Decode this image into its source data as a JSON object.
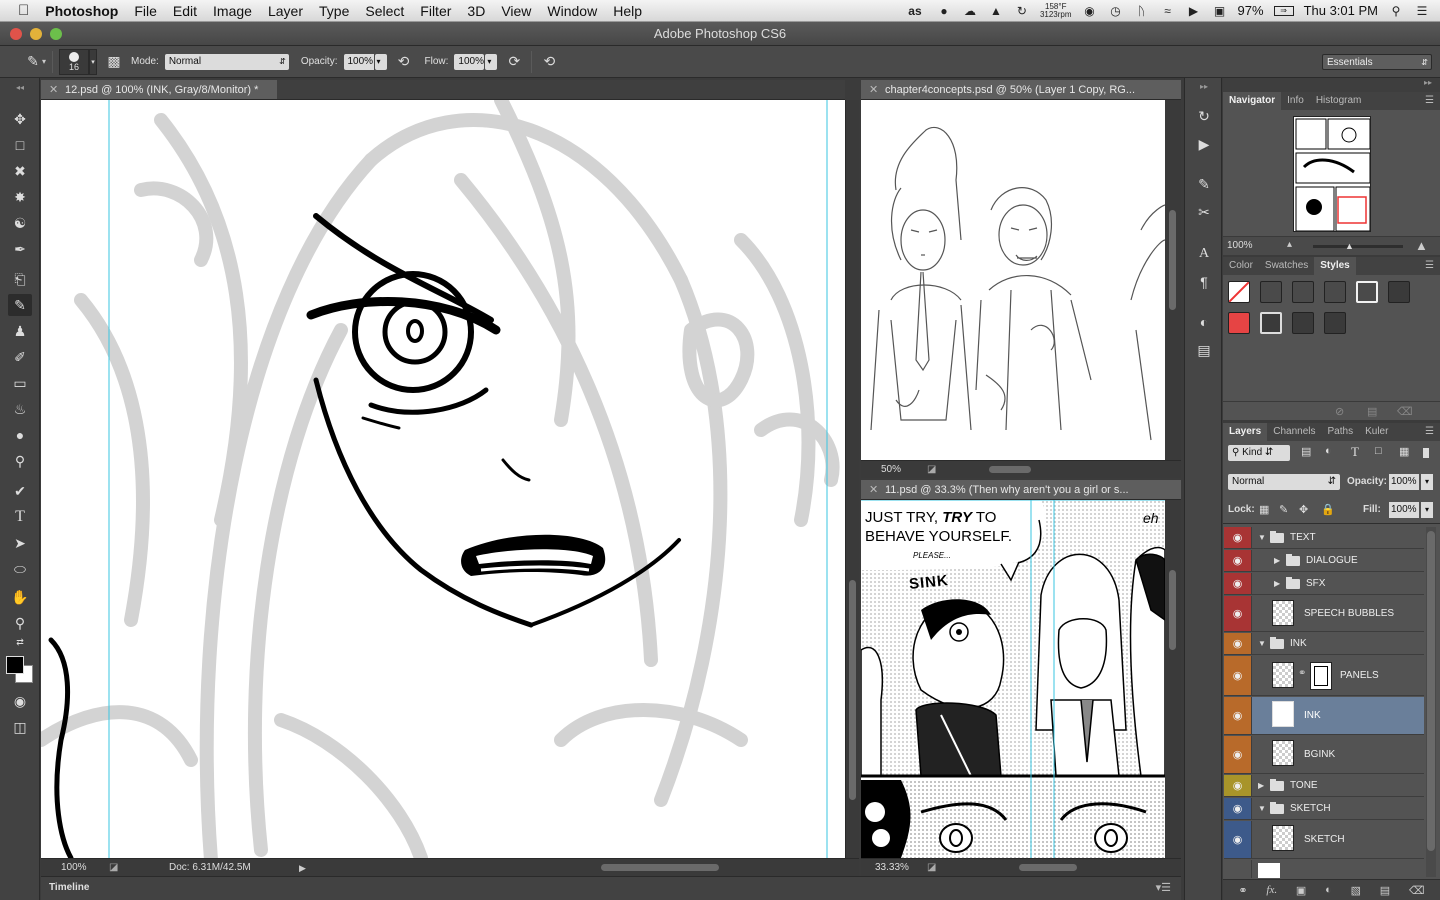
{
  "menubar": {
    "app": "Photoshop",
    "items": [
      "File",
      "Edit",
      "Image",
      "Layer",
      "Type",
      "Select",
      "Filter",
      "3D",
      "View",
      "Window",
      "Help"
    ],
    "temp": "158°F",
    "rpm": "3123rpm",
    "battery": "97%",
    "clock": "Thu 3:01 PM"
  },
  "window": {
    "title": "Adobe Photoshop CS6"
  },
  "options": {
    "brush_size": "16",
    "mode_label": "Mode:",
    "mode_value": "Normal",
    "opacity_label": "Opacity:",
    "opacity_value": "100%",
    "flow_label": "Flow:",
    "flow_value": "100%",
    "workspace": "Essentials"
  },
  "docs": {
    "main": {
      "tab": "12.psd @ 100% (INK, Gray/8/Monitor) *",
      "zoom": "100%",
      "doc_info": "Doc: 6.31M/42.5M"
    },
    "top_right": {
      "tab": "chapter4concepts.psd @ 50% (Layer 1 Copy, RG...",
      "zoom": "50%"
    },
    "bottom_right": {
      "tab": "11.psd @ 33.3% (Then why aren't you a girl or s...",
      "zoom": "33.33%"
    }
  },
  "comic": {
    "bubble_line1": "JUST TRY, ",
    "bubble_try": "TRY",
    "bubble_line1_end": " TO",
    "bubble_line2": "BEHAVE YOURSELF.",
    "bubble_please": "PLEASE...",
    "sfx": "SINK",
    "side": "eh"
  },
  "timeline": {
    "label": "Timeline"
  },
  "navigator": {
    "tabs": [
      "Navigator",
      "Info",
      "Histogram"
    ],
    "zoom": "100%"
  },
  "styles_panel": {
    "tabs": [
      "Color",
      "Swatches",
      "Styles"
    ],
    "active_tab": "Styles",
    "swatch_colors": [
      "#4a4a4a",
      "#4a4a4a",
      "#4a4a4a",
      "#3a3a3a",
      "#e64444",
      "#3a3a3a",
      "#3a3a3a",
      "#4a4a4a",
      "#4fc3f0"
    ]
  },
  "layers_panel": {
    "tabs": [
      "Layers",
      "Channels",
      "Paths",
      "Kuler"
    ],
    "kind": "Kind",
    "blend": "Normal",
    "opacity_label": "Opacity:",
    "opacity_value": "100%",
    "lock_label": "Lock:",
    "fill_label": "Fill:",
    "fill_value": "100%",
    "layers": [
      {
        "name": "TEXT",
        "type": "group",
        "color": "#a83434"
      },
      {
        "name": "DIALOGUE",
        "type": "group",
        "color": "#a83434"
      },
      {
        "name": "SFX",
        "type": "group",
        "color": "#a83434"
      },
      {
        "name": "SPEECH BUBBLES",
        "type": "layer",
        "color": "#a83434"
      },
      {
        "name": "INK",
        "type": "group",
        "color": "#b86a2a"
      },
      {
        "name": "PANELS",
        "type": "layer",
        "color": "#b86a2a"
      },
      {
        "name": "INK",
        "type": "layer",
        "color": "#b86a2a",
        "selected": true
      },
      {
        "name": "BGINK",
        "type": "layer",
        "color": "#b86a2a"
      },
      {
        "name": "TONE",
        "type": "group",
        "color": "#a8942a"
      },
      {
        "name": "SKETCH",
        "type": "group",
        "color": "#3d5a8a"
      },
      {
        "name": "SKETCH",
        "type": "layer",
        "color": "#3d5a8a"
      }
    ]
  }
}
